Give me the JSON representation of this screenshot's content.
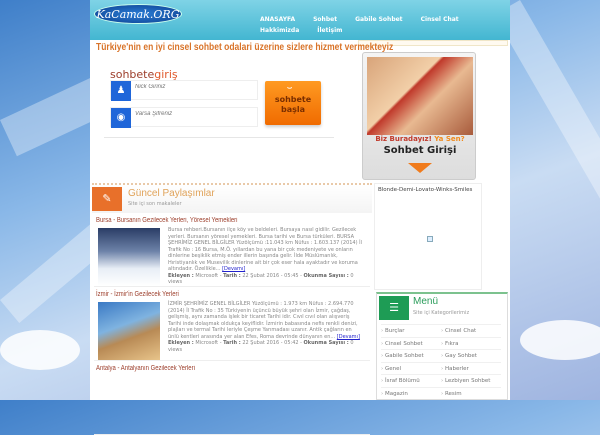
{
  "header": {
    "logo": "KaCamak.ORG",
    "nav": [
      "ANASAYFA",
      "Sohbet",
      "Gabile Sohbet",
      "Cinsel Chat",
      "Hakkimizda",
      "İletişim"
    ]
  },
  "tagline": "Türkiye'nin en iyi cinsel sohbet odalari üzerine sizlere hizmet vermekteyiz",
  "login": {
    "title_a": "sohbete",
    "title_b": "giriş",
    "nick_placeholder": "Nick Giriniz",
    "pass_placeholder": "Varsa Şifreniz",
    "button": "sohbete başla",
    "button_icon": "smile-icon"
  },
  "ad": {
    "line1a": "Biz Buradayız!",
    "line1b": "Ya Sen?",
    "line2": "Sohbet Girişi"
  },
  "posts": {
    "title": "Güncel Paylaşımlar",
    "subtitle": "Site içi son makaleler",
    "items": [
      {
        "title": "Bursa - Bursanın Gezilecek Yerleri, Yöresel Yemekleri",
        "excerpt": "Bursa rehberi.Bursanın ilçe köy ve beldeleri. Bursaya nasıl gidilir. Gezilecek yerleri. Bursanın yöresel yemekleri. Bursa tarihi ve Bursa türküleri. BURSA ŞEHRİMİZ GENEL BİLGİLER Yüzölçümü :11.043 km Nüfus : 1.603.137 (2014) İl Trafik No : 16 Bursa, M.Ö. yıllardan bu yana bir çok medeniyete ve onların dinlerine beşiklik etmiş ender illerin başında gelir. İlde Müslümanlık, Hıristiyanlık ve Musevilik dinlerine ait bir çok eser hala ayaktadır ve koruma altındadır. Özellikle...",
        "more": "[Devamı]",
        "added_label": "Ekleyen :",
        "author": "Microsoft",
        "date_label": "Tarih :",
        "date": "22 Şubat 2016 - 05:45",
        "reads_label": "Okunma Sayısı :",
        "reads": "0 views"
      },
      {
        "title": "İzmir - İzmir'in Gezilecek Yerleri",
        "excerpt": "İZMİR ŞEHRİMİZ GENEL BİLGİLER Yüzölçümü : 1.973 km Nüfus : 2.694.770 (2014) İl Trafik No : 35 Türkiyenin üçüncü büyük şehri olan İzmir, çağdaş, gelişmiş, aynı zamanda işlek bir ticaret Tarihi idir. Cıvıl cıvıl olan alışveriş Tarihi inde dolaşmak oldukça keyiflidir. İzmirin babasında nefis renkli denizi, plajları ve termal Tarihi leriyle Çeşme Yarımadası uzanır. Antik çağların en ünlü kentleri arasında yer alan Efes, Roma devrinde dünyanın en...",
        "more": "[Devamı]",
        "added_label": "Ekleyen :",
        "author": "Microsoft",
        "date_label": "Tarih :",
        "date": "22 Şubat 2016 - 05:42",
        "reads_label": "Okunma Sayısı :",
        "reads": "0 views"
      },
      {
        "title": "Antalya - Antalyanın Gezilecek Yerleri"
      }
    ]
  },
  "widget": {
    "caption": "Blonde-Demi-Lovato-Winks-Smiles"
  },
  "menu": {
    "title": "Menü",
    "subtitle": "Site içi Kategorilerimiz",
    "items": [
      "Burçlar",
      "Cinsel Chat",
      "Cinsel Sohbet",
      "Fıkra",
      "Gabile Sohbet",
      "Gay Sohbet",
      "Genel",
      "Haberler",
      "İsraf Bölümü",
      "Lezbiyen Sohbet",
      "Magazin",
      "Resim"
    ]
  }
}
